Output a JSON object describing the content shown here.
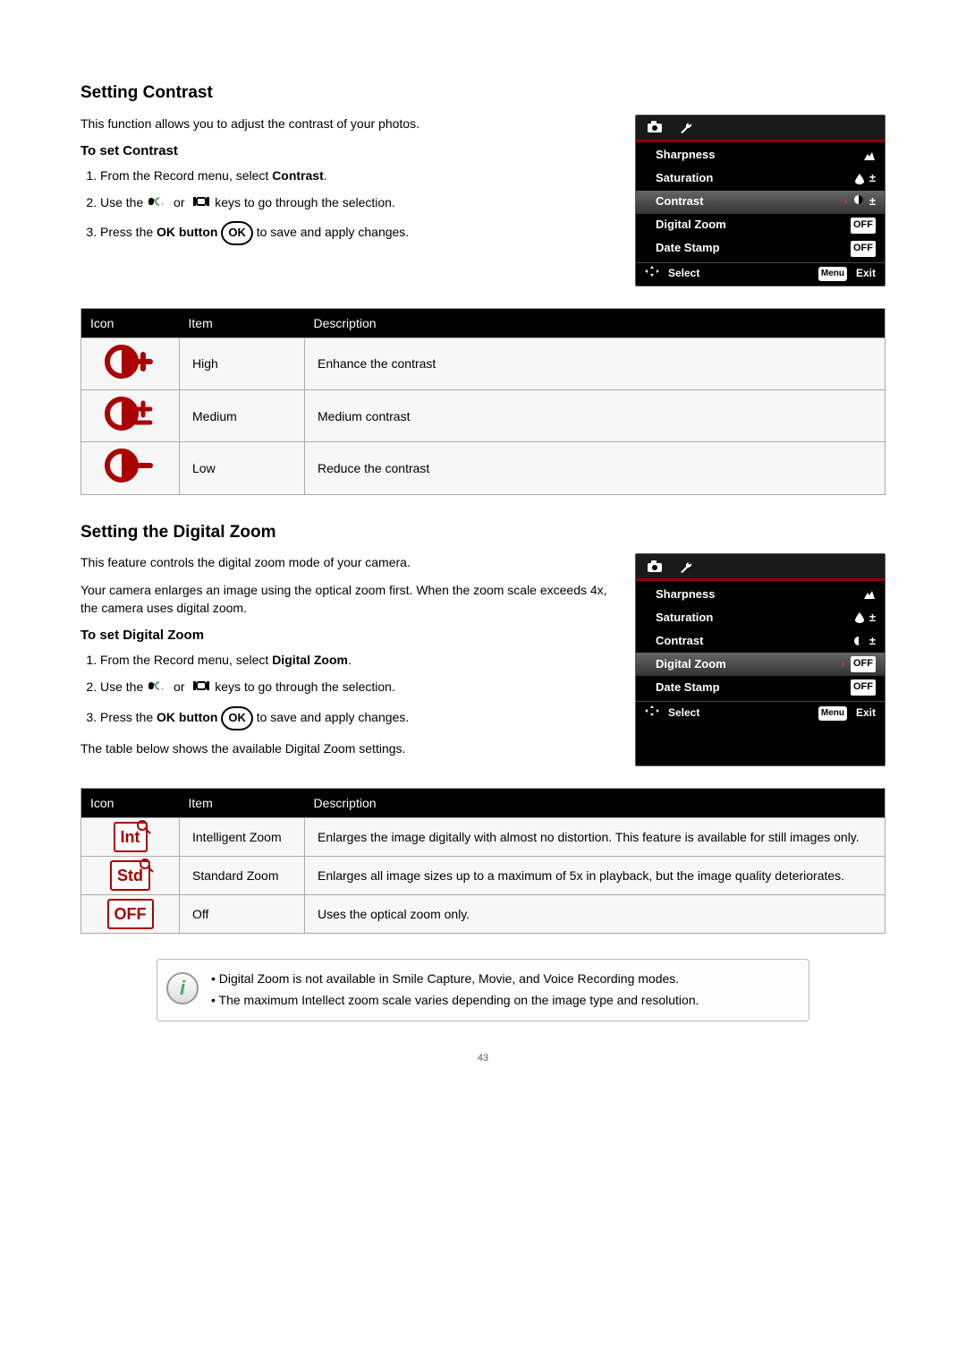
{
  "sections": {
    "contrast": {
      "heading": "Setting Contrast",
      "intro": "This function allows you to adjust the contrast of your photos.",
      "sub_heading": "To set Contrast",
      "steps": [
        {
          "pre": "From the Record menu, select ",
          "bold": "Contrast",
          "post": "."
        },
        {
          "pre": "Use the ",
          "post": " keys to go through the selection."
        },
        {
          "pre": "Press the ",
          "bold": "OK button",
          "post": " to save and apply changes."
        }
      ],
      "table_headers": [
        "Icon",
        "Item",
        "Description"
      ],
      "table": [
        {
          "item": "High",
          "desc": "Enhance the contrast"
        },
        {
          "item": "Medium",
          "desc": "Medium contrast"
        },
        {
          "item": "Low",
          "desc": "Reduce the contrast"
        }
      ]
    },
    "zoom": {
      "heading": "Setting the Digital Zoom",
      "intro1": "This feature controls the digital zoom mode of your camera.",
      "intro2": "Your camera enlarges an image using the optical zoom first. When the zoom scale exceeds 4x, the camera uses digital zoom.",
      "sub_heading": "To set Digital Zoom",
      "steps": [
        {
          "pre": "From the Record menu, select ",
          "bold": "Digital Zoom",
          "post": "."
        },
        {
          "pre": "Use the ",
          "post": " keys to go through the selection."
        },
        {
          "pre": "Press the ",
          "bold": "OK button",
          "post": " to save and apply changes."
        }
      ],
      "table_lead": "The table below shows the available Digital Zoom settings.",
      "table_headers": [
        "Icon",
        "Item",
        "Description"
      ],
      "table": [
        {
          "icon_label": "Int",
          "item": "Intelligent Zoom",
          "desc": "Enlarges the image digitally with almost no distortion. This feature is available for still images only."
        },
        {
          "icon_label": "Std",
          "item": "Standard Zoom",
          "desc": "Enlarges all image sizes up to a maximum of 5x in playback, but the image quality deteriorates."
        },
        {
          "icon_label": "OFF",
          "item": "Off",
          "desc": "Uses the optical zoom only."
        }
      ]
    }
  },
  "camera_menu": {
    "rows": [
      {
        "label": "Sharpness",
        "iconName": "sharpness-icon"
      },
      {
        "label": "Saturation",
        "iconName": "saturation-icon"
      },
      {
        "label": "Contrast",
        "iconName": "contrast-icon"
      },
      {
        "label": "Digital Zoom",
        "iconName": "digital-zoom-off"
      },
      {
        "label": "Date Stamp",
        "iconName": "date-stamp-off"
      }
    ],
    "footer_select": "Select",
    "footer_menu": "Menu",
    "footer_exit": "Exit",
    "active_contrast_index": 2,
    "active_zoom_index": 3
  },
  "note": {
    "items": [
      "Digital Zoom is not available in Smile Capture, Movie, and Voice Recording modes.",
      "The maximum Intellect zoom scale varies depending on the image type and resolution."
    ]
  },
  "misc": {
    "off_label": "OFF",
    "or_word": "or",
    "page_number": "43"
  }
}
